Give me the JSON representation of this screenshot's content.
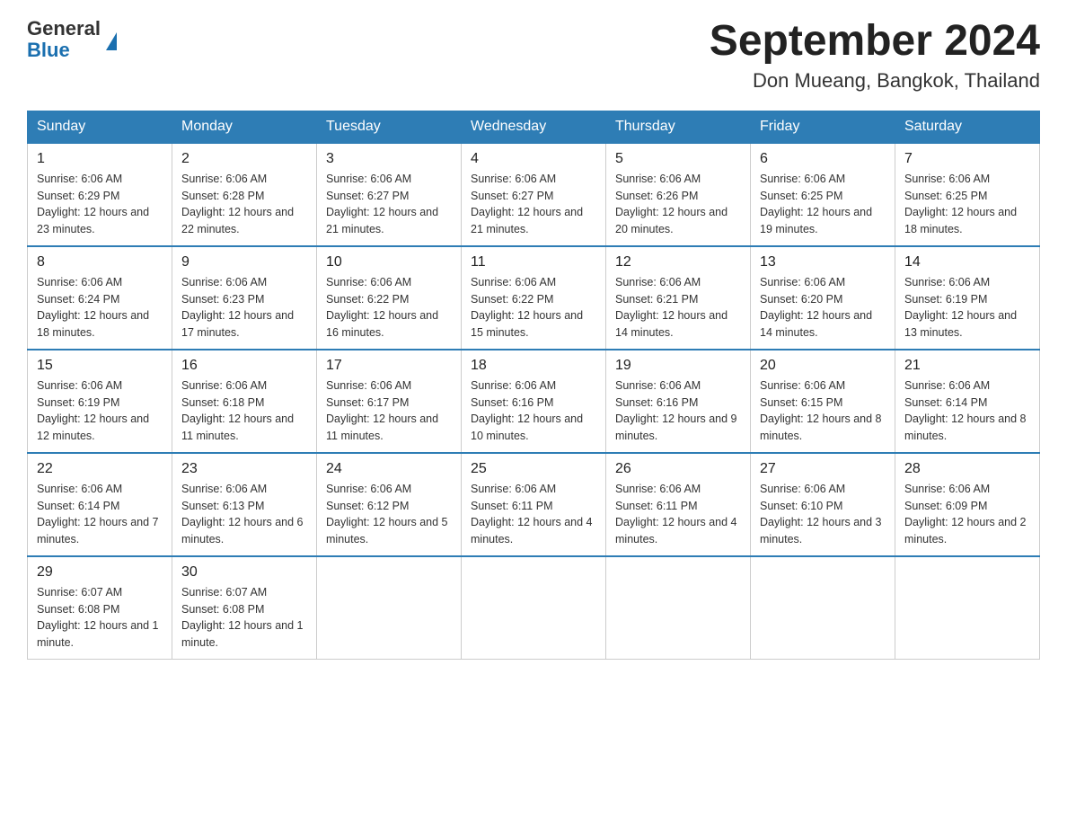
{
  "header": {
    "logo_general": "General",
    "logo_blue": "Blue",
    "month_title": "September 2024",
    "location": "Don Mueang, Bangkok, Thailand"
  },
  "days_of_week": [
    "Sunday",
    "Monday",
    "Tuesday",
    "Wednesday",
    "Thursday",
    "Friday",
    "Saturday"
  ],
  "weeks": [
    [
      {
        "day": "1",
        "sunrise": "Sunrise: 6:06 AM",
        "sunset": "Sunset: 6:29 PM",
        "daylight": "Daylight: 12 hours and 23 minutes."
      },
      {
        "day": "2",
        "sunrise": "Sunrise: 6:06 AM",
        "sunset": "Sunset: 6:28 PM",
        "daylight": "Daylight: 12 hours and 22 minutes."
      },
      {
        "day": "3",
        "sunrise": "Sunrise: 6:06 AM",
        "sunset": "Sunset: 6:27 PM",
        "daylight": "Daylight: 12 hours and 21 minutes."
      },
      {
        "day": "4",
        "sunrise": "Sunrise: 6:06 AM",
        "sunset": "Sunset: 6:27 PM",
        "daylight": "Daylight: 12 hours and 21 minutes."
      },
      {
        "day": "5",
        "sunrise": "Sunrise: 6:06 AM",
        "sunset": "Sunset: 6:26 PM",
        "daylight": "Daylight: 12 hours and 20 minutes."
      },
      {
        "day": "6",
        "sunrise": "Sunrise: 6:06 AM",
        "sunset": "Sunset: 6:25 PM",
        "daylight": "Daylight: 12 hours and 19 minutes."
      },
      {
        "day": "7",
        "sunrise": "Sunrise: 6:06 AM",
        "sunset": "Sunset: 6:25 PM",
        "daylight": "Daylight: 12 hours and 18 minutes."
      }
    ],
    [
      {
        "day": "8",
        "sunrise": "Sunrise: 6:06 AM",
        "sunset": "Sunset: 6:24 PM",
        "daylight": "Daylight: 12 hours and 18 minutes."
      },
      {
        "day": "9",
        "sunrise": "Sunrise: 6:06 AM",
        "sunset": "Sunset: 6:23 PM",
        "daylight": "Daylight: 12 hours and 17 minutes."
      },
      {
        "day": "10",
        "sunrise": "Sunrise: 6:06 AM",
        "sunset": "Sunset: 6:22 PM",
        "daylight": "Daylight: 12 hours and 16 minutes."
      },
      {
        "day": "11",
        "sunrise": "Sunrise: 6:06 AM",
        "sunset": "Sunset: 6:22 PM",
        "daylight": "Daylight: 12 hours and 15 minutes."
      },
      {
        "day": "12",
        "sunrise": "Sunrise: 6:06 AM",
        "sunset": "Sunset: 6:21 PM",
        "daylight": "Daylight: 12 hours and 14 minutes."
      },
      {
        "day": "13",
        "sunrise": "Sunrise: 6:06 AM",
        "sunset": "Sunset: 6:20 PM",
        "daylight": "Daylight: 12 hours and 14 minutes."
      },
      {
        "day": "14",
        "sunrise": "Sunrise: 6:06 AM",
        "sunset": "Sunset: 6:19 PM",
        "daylight": "Daylight: 12 hours and 13 minutes."
      }
    ],
    [
      {
        "day": "15",
        "sunrise": "Sunrise: 6:06 AM",
        "sunset": "Sunset: 6:19 PM",
        "daylight": "Daylight: 12 hours and 12 minutes."
      },
      {
        "day": "16",
        "sunrise": "Sunrise: 6:06 AM",
        "sunset": "Sunset: 6:18 PM",
        "daylight": "Daylight: 12 hours and 11 minutes."
      },
      {
        "day": "17",
        "sunrise": "Sunrise: 6:06 AM",
        "sunset": "Sunset: 6:17 PM",
        "daylight": "Daylight: 12 hours and 11 minutes."
      },
      {
        "day": "18",
        "sunrise": "Sunrise: 6:06 AM",
        "sunset": "Sunset: 6:16 PM",
        "daylight": "Daylight: 12 hours and 10 minutes."
      },
      {
        "day": "19",
        "sunrise": "Sunrise: 6:06 AM",
        "sunset": "Sunset: 6:16 PM",
        "daylight": "Daylight: 12 hours and 9 minutes."
      },
      {
        "day": "20",
        "sunrise": "Sunrise: 6:06 AM",
        "sunset": "Sunset: 6:15 PM",
        "daylight": "Daylight: 12 hours and 8 minutes."
      },
      {
        "day": "21",
        "sunrise": "Sunrise: 6:06 AM",
        "sunset": "Sunset: 6:14 PM",
        "daylight": "Daylight: 12 hours and 8 minutes."
      }
    ],
    [
      {
        "day": "22",
        "sunrise": "Sunrise: 6:06 AM",
        "sunset": "Sunset: 6:14 PM",
        "daylight": "Daylight: 12 hours and 7 minutes."
      },
      {
        "day": "23",
        "sunrise": "Sunrise: 6:06 AM",
        "sunset": "Sunset: 6:13 PM",
        "daylight": "Daylight: 12 hours and 6 minutes."
      },
      {
        "day": "24",
        "sunrise": "Sunrise: 6:06 AM",
        "sunset": "Sunset: 6:12 PM",
        "daylight": "Daylight: 12 hours and 5 minutes."
      },
      {
        "day": "25",
        "sunrise": "Sunrise: 6:06 AM",
        "sunset": "Sunset: 6:11 PM",
        "daylight": "Daylight: 12 hours and 4 minutes."
      },
      {
        "day": "26",
        "sunrise": "Sunrise: 6:06 AM",
        "sunset": "Sunset: 6:11 PM",
        "daylight": "Daylight: 12 hours and 4 minutes."
      },
      {
        "day": "27",
        "sunrise": "Sunrise: 6:06 AM",
        "sunset": "Sunset: 6:10 PM",
        "daylight": "Daylight: 12 hours and 3 minutes."
      },
      {
        "day": "28",
        "sunrise": "Sunrise: 6:06 AM",
        "sunset": "Sunset: 6:09 PM",
        "daylight": "Daylight: 12 hours and 2 minutes."
      }
    ],
    [
      {
        "day": "29",
        "sunrise": "Sunrise: 6:07 AM",
        "sunset": "Sunset: 6:08 PM",
        "daylight": "Daylight: 12 hours and 1 minute."
      },
      {
        "day": "30",
        "sunrise": "Sunrise: 6:07 AM",
        "sunset": "Sunset: 6:08 PM",
        "daylight": "Daylight: 12 hours and 1 minute."
      },
      null,
      null,
      null,
      null,
      null
    ]
  ]
}
